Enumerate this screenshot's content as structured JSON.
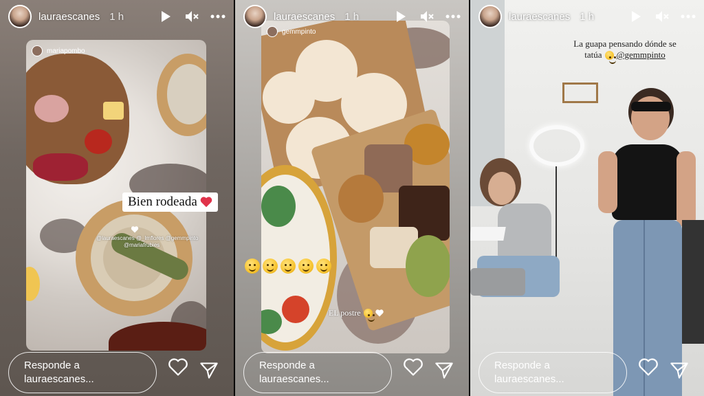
{
  "stories": [
    {
      "username": "lauraescanes",
      "time": "1 h",
      "source_tag": "mariapombo",
      "sticker": "Bien rodeada",
      "mentions_line1": "@lauraescanes @_lmflores @gemmpinto",
      "mentions_line2": "@mariafrubies",
      "reply_line1": "Responde a",
      "reply_line2": "lauraescanes..."
    },
    {
      "username": "lauraescanes",
      "time": "1 h",
      "source_tag": "gemmpinto",
      "caption": "EL postre",
      "reply_line1": "Responde a",
      "reply_line2": "lauraescanes..."
    },
    {
      "username": "lauraescanes",
      "time": "1 h",
      "caption_line1": "La guapa pensando dónde se",
      "caption_line2": "tatúa",
      "caption_mention": "@gemmpinto",
      "reply_line1": "Responde a",
      "reply_line2": "lauraescanes..."
    }
  ],
  "icons": {
    "play": "play-icon",
    "mute": "muted-speaker-icon",
    "more": "more-horizontal-icon",
    "like": "heart-icon",
    "share": "send-icon"
  },
  "colors": {
    "sticker_bg": "#ffffff",
    "heart_emoji": "#e0334a",
    "emoji_yellow": "#f7c431"
  }
}
